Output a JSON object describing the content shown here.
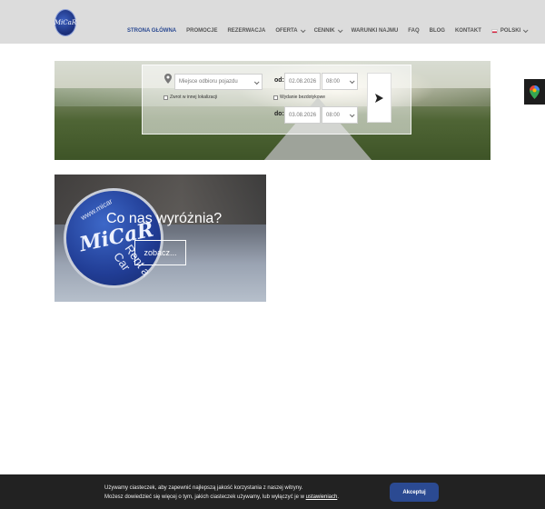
{
  "header": {
    "logo_text": "MiCaR",
    "nav": [
      {
        "label": "STRONA GŁÓWNA",
        "active": true,
        "dropdown": false
      },
      {
        "label": "PROMOCJE",
        "active": false,
        "dropdown": false
      },
      {
        "label": "REZERWACJA",
        "active": false,
        "dropdown": false
      },
      {
        "label": "OFERTA",
        "active": false,
        "dropdown": true
      },
      {
        "label": "CENNIK",
        "active": false,
        "dropdown": true
      },
      {
        "label": "WARUNKI NAJMU",
        "active": false,
        "dropdown": false
      },
      {
        "label": "FAQ",
        "active": false,
        "dropdown": false
      },
      {
        "label": "BLOG",
        "active": false,
        "dropdown": false
      },
      {
        "label": "KONTAKT",
        "active": false,
        "dropdown": false
      }
    ],
    "language": "POLSKI"
  },
  "booking": {
    "pickup_placeholder": "Miejsce odbioru pojazdu",
    "return_other_label": "Zwrot w innej lokalizacji",
    "delivery_label": "Wydanie bezdotykowe",
    "from_label": "od:",
    "to_label": "do:",
    "from_date": "02.08.2026",
    "from_time": "08:00",
    "to_date": "03.08.2026",
    "to_time": "08:00"
  },
  "promo": {
    "title": "Co nas wyróżnia?",
    "button": "zobacz..."
  },
  "cookie": {
    "line1": "Używamy ciasteczek, aby zapewnić najlepszą jakość korzystania z naszej witryny.",
    "line2_prefix": "Możesz dowiedzieć się więcej o tym, jakich ciasteczek używamy, lub wyłączyć je w ",
    "line2_link": "ustawieniach",
    "line2_suffix": ".",
    "accept": "Akceptuj"
  },
  "colors": {
    "header_bg": "#dcdcdc",
    "brand_blue": "#2b4a92",
    "cookie_bg": "#222222"
  }
}
